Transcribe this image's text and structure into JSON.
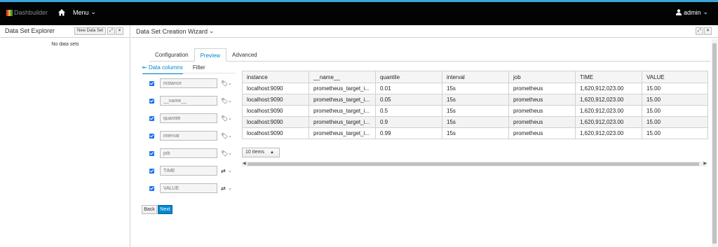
{
  "nav": {
    "brand": "Dashbuilder",
    "menu_label": "Menu",
    "user_label": "admin"
  },
  "explorer": {
    "title": "Data Set Explorer",
    "new_button": "New Data Set",
    "empty_text": "No data sets"
  },
  "wizard": {
    "title": "Data Set Creation Wizard",
    "tabs": [
      {
        "label": "Configuration"
      },
      {
        "label": "Preview"
      },
      {
        "label": "Advanced"
      }
    ],
    "subtabs": [
      {
        "label": "Data columns"
      },
      {
        "label": "Filter"
      }
    ],
    "columns": [
      {
        "placeholder": "instance",
        "type_icon": "tag-icon"
      },
      {
        "placeholder": "__name__",
        "type_icon": "tag-icon"
      },
      {
        "placeholder": "quantile",
        "type_icon": "tag-icon"
      },
      {
        "placeholder": "interval",
        "type_icon": "tag-icon"
      },
      {
        "placeholder": "job",
        "type_icon": "tag-icon"
      },
      {
        "placeholder": "TIME",
        "type_icon": "number-icon"
      },
      {
        "placeholder": "VALUE",
        "type_icon": "number-icon"
      }
    ],
    "back_label": "Back",
    "next_label": "Next"
  },
  "table": {
    "headers": [
      "instance",
      "__name__",
      "quantile",
      "interval",
      "job",
      "TIME",
      "VALUE"
    ],
    "rows": [
      [
        "localhost:9090",
        "prometheus_target_i...",
        "0.01",
        "15s",
        "prometheus",
        "1,620,912,023.00",
        "15.00"
      ],
      [
        "localhost:9090",
        "prometheus_target_i...",
        "0.05",
        "15s",
        "prometheus",
        "1,620,912,023.00",
        "15.00"
      ],
      [
        "localhost:9090",
        "prometheus_target_i...",
        "0.5",
        "15s",
        "prometheus",
        "1,620,912,023.00",
        "15.00"
      ],
      [
        "localhost:9090",
        "prometheus_target_i...",
        "0.9",
        "15s",
        "prometheus",
        "1,620,912,023.00",
        "15.00"
      ],
      [
        "localhost:9090",
        "prometheus_target_i...",
        "0.99",
        "15s",
        "prometheus",
        "1,620,912,023.00",
        "15.00"
      ]
    ],
    "page_size_label": "10 Items"
  },
  "colors": {
    "accent": "#0088ce",
    "topbar": "#030303",
    "topbar_border": "#39a5dc"
  }
}
